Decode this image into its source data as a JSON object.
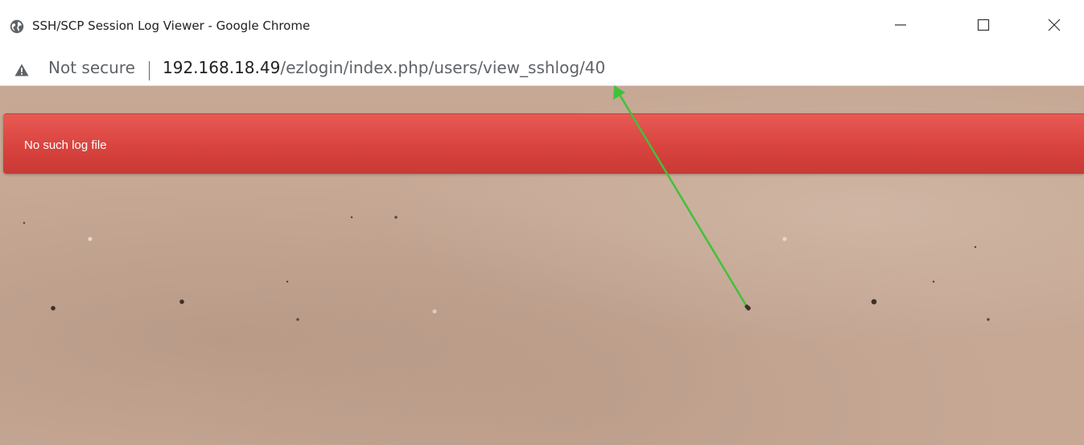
{
  "window": {
    "title": "SSH/SCP Session Log Viewer - Google Chrome"
  },
  "address_bar": {
    "security_label": "Not secure",
    "url_host": "192.168.18.49",
    "url_path": "/ezlogin/index.php/users/view_sshlog/40"
  },
  "alert": {
    "message": "No such log file"
  },
  "icons": {
    "site": "globe-icon",
    "security": "warning-triangle-icon",
    "minimize": "minimize-icon",
    "maximize": "maximize-icon",
    "close": "close-icon"
  },
  "colors": {
    "alert_background": "#d9433e",
    "page_background": "#c6a895",
    "annotation_arrow": "#3fc23a"
  }
}
